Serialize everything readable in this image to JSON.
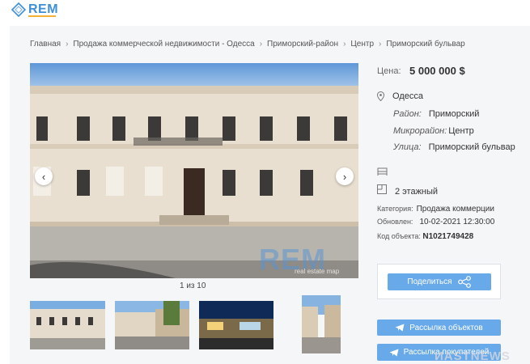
{
  "logo": {
    "text": "REM"
  },
  "breadcrumb": [
    "Главная",
    "Продажа коммерческой недвижимости - Одесса",
    "Приморский-район",
    "Центр",
    "Приморский бульвар"
  ],
  "gallery": {
    "counter": "1 из 10",
    "watermark": "REM",
    "watermark_sub": "real estate map"
  },
  "price": {
    "label": "Цена:",
    "value": "5 000 000 $"
  },
  "location": {
    "city": "Одесса",
    "district_label": "Район:",
    "district": "Приморский",
    "microdistrict_label": "Микрорайон:",
    "microdistrict": "Центр",
    "street_label": "Улица:",
    "street": "Приморский бульвар"
  },
  "details": {
    "floors": "2 этажный",
    "category_label": "Категория:",
    "category": "Продажа коммерции",
    "updated_label": "Обновлен:",
    "updated": "10-02-2021 12:30:00",
    "code_label": "Код объекта:",
    "code": "N1021749428"
  },
  "buttons": {
    "share": "Поделиться",
    "mailing_objects": "Рассылка объектов",
    "mailing_buyers": "Рассылка покупателей"
  },
  "page_watermark": "ИASTNEWS",
  "colors": {
    "accent": "#68a9ea",
    "brand": "#3d8fd8",
    "brand_sub": "#f2b233"
  },
  "icons": [
    "logo-icon",
    "chevron-right-icon",
    "chevron-left-icon",
    "map-pin-icon",
    "bed-icon",
    "floor-plan-icon",
    "share-icon",
    "telegram-icon"
  ]
}
